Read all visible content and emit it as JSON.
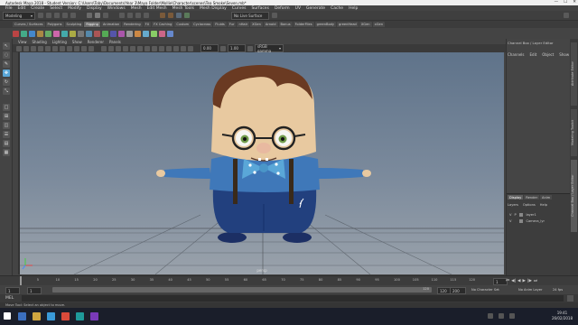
{
  "window": {
    "title": "Autodesk Maya 2018 - Student Version: C:\\Users\\Toby\\Documents\\Year 3\\Maya Folder\\Mollie\\Character\\scenes\\Tea Smoke\\Seven.mb*",
    "minimize": "—",
    "maximize": "☐",
    "close": "✕"
  },
  "menubar": [
    "File",
    "Edit",
    "Create",
    "Select",
    "Modify",
    "Display",
    "Windows",
    "Mesh",
    "Edit Mesh",
    "Mesh Tools",
    "Mesh Display",
    "Curves",
    "Surfaces",
    "Deform",
    "UV",
    "Generate",
    "Cache",
    "Help"
  ],
  "statusline": {
    "mode": "Modeling",
    "live_surface": "No Live Surface"
  },
  "shelf_tabs": [
    {
      "label": "Curves / Surfaces",
      "active": false
    },
    {
      "label": "Polygons",
      "active": false
    },
    {
      "label": "Sculpting",
      "active": false
    },
    {
      "label": "Rigging",
      "active": true
    },
    {
      "label": "Animation",
      "active": false
    },
    {
      "label": "Rendering",
      "active": false
    },
    {
      "label": "FX",
      "active": false
    },
    {
      "label": "FX Caching",
      "active": false
    },
    {
      "label": "Custom",
      "active": false
    },
    {
      "label": "Cyclocross",
      "active": false
    },
    {
      "label": "Fluids",
      "active": false
    },
    {
      "label": "Fur",
      "active": false
    },
    {
      "label": "nHair",
      "active": false
    },
    {
      "label": "XGen",
      "active": false
    },
    {
      "label": "Arnold",
      "active": false
    },
    {
      "label": "Bonus",
      "active": false
    },
    {
      "label": "FolderFiles",
      "active": false
    },
    {
      "label": "greenBody",
      "active": false
    },
    {
      "label": "greenHead",
      "active": false
    },
    {
      "label": "XGen",
      "active": false
    },
    {
      "label": "xGen",
      "active": false
    }
  ],
  "panel_menu": [
    "View",
    "Shading",
    "Lighting",
    "Show",
    "Renderer",
    "Panels"
  ],
  "panel_toolbar": {
    "value1": "0.00",
    "value2": "1.00",
    "color_space": "sRGB gamma"
  },
  "viewport": {
    "camera_label": "persp"
  },
  "channel_box": {
    "title": "Channel Box / Layer Editor",
    "menu": [
      "Channels",
      "Edit",
      "Object",
      "Show"
    ]
  },
  "layer_editor": {
    "tabs": [
      {
        "label": "Display",
        "active": true
      },
      {
        "label": "Render",
        "active": false
      },
      {
        "label": "Anim",
        "active": false
      }
    ],
    "submenu": [
      "Layers",
      "Options",
      "Help"
    ],
    "layers": [
      {
        "v": "V",
        "p": "P",
        "name": "layer1"
      },
      {
        "v": "V",
        "p": "",
        "name": "Camera_lyr"
      }
    ]
  },
  "side_tabs": [
    "Attribute Editor",
    "Modeling Toolkit",
    "Channel Box / Layer Editor"
  ],
  "timeslider": {
    "ticks": [
      "5",
      "10",
      "15",
      "20",
      "25",
      "30",
      "35",
      "40",
      "45",
      "50",
      "55",
      "60",
      "65",
      "70",
      "75",
      "80",
      "85",
      "90",
      "95",
      "100",
      "105",
      "110",
      "115",
      "120"
    ],
    "current_frame": "1"
  },
  "rangeslider": {
    "start": "1",
    "inner_start": "1",
    "range_end_label": "120",
    "end": "120",
    "max": "200",
    "char_set": "No Character Set",
    "anim_layer": "No Anim Layer",
    "fps": "24 fps"
  },
  "cmdline": {
    "lang": "MEL"
  },
  "helpline": {
    "text": "Move Tool: Select an object to move."
  },
  "taskbar": {
    "time": "19:41",
    "date": "26/02/2018"
  },
  "colors": {
    "accent": "#5aa7d8",
    "shirt": "#3f78b9",
    "pants": "#1f3a7a",
    "hair": "#6a3a22",
    "skin": "#e8c9a0"
  }
}
